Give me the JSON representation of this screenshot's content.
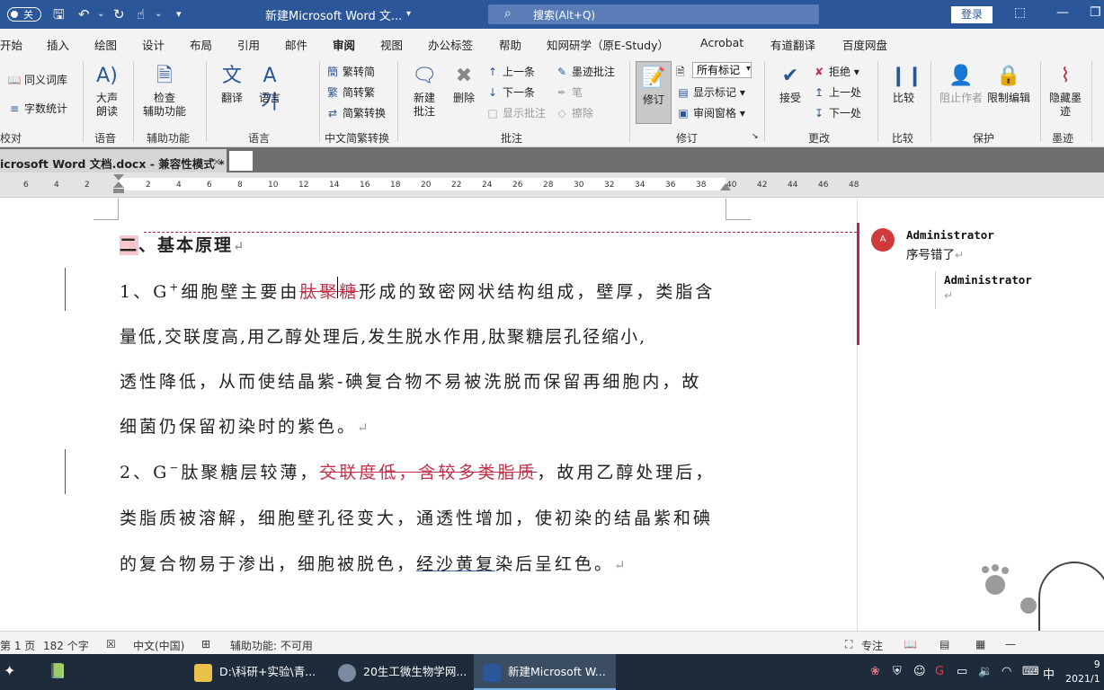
{
  "titlebar": {
    "autosave_label": "关",
    "doc_title": "新建Microsoft Word 文...",
    "search_placeholder": "搜索(Alt+Q)",
    "login_label": "登录"
  },
  "tabs": [
    "开始",
    "插入",
    "绘图",
    "设计",
    "布局",
    "引用",
    "邮件",
    "审阅",
    "视图",
    "办公标签",
    "帮助",
    "知网研学（原E-Study）",
    "Acrobat",
    "有道翻译",
    "百度网盘"
  ],
  "active_tab": "审阅",
  "ribbon": {
    "proofing": {
      "synonyms": "同义词库",
      "word_count": "字数统计",
      "label": "校对"
    },
    "speech": {
      "read_aloud": "大声\n朗读",
      "label": "语音"
    },
    "accessibility": {
      "check": "检查\n辅助功能",
      "label": "辅助功能"
    },
    "language": {
      "translate": "翻译",
      "language": "语言",
      "label": "语言"
    },
    "chinese": {
      "t2s": "繁转简",
      "s2t": "简转繁",
      "convert": "简繁转换",
      "label": "中文简繁转换"
    },
    "comments": {
      "new": "新建\n批注",
      "delete": "删除",
      "prev": "上一条",
      "next": "下一条",
      "show": "显示批注",
      "ink": "墨迹批注",
      "pen": "笔",
      "erase": "擦除",
      "label": "批注"
    },
    "tracking": {
      "track": "修订",
      "markup": "所有标记",
      "show_markup": "显示标记",
      "pane": "审阅窗格",
      "label": "修订"
    },
    "changes": {
      "accept": "接受",
      "reject": "拒绝",
      "prev": "上一处",
      "next": "下一处",
      "label": "更改"
    },
    "compare": {
      "compare": "比较",
      "label": "比较"
    },
    "protect": {
      "block": "阻止作者",
      "restrict": "限制编辑",
      "label": "保护"
    },
    "ink": {
      "hide": "隐藏墨\n迹",
      "label": "墨迹"
    }
  },
  "doc_tab": {
    "name": "icrosoft Word 文档.docx  -  兼容性模式 *",
    "close": "×"
  },
  "ruler_numbers": [
    "6",
    "4",
    "2",
    "2",
    "4",
    "6",
    "8",
    "10",
    "12",
    "14",
    "16",
    "18",
    "20",
    "22",
    "24",
    "26",
    "28",
    "30",
    "32",
    "34",
    "36",
    "38",
    "40",
    "42",
    "44",
    "46",
    "48"
  ],
  "document": {
    "heading_num": "二",
    "heading_rest": "、基本原理",
    "p1_a": "1、G",
    "p1_sup": "+",
    "p1_b": "细胞壁主要由",
    "p1_del": "肽聚糖",
    "p1_c": "形成的致密网状结构组成，壁厚，类脂含",
    "p1_l2": "量低,交联度高,用乙醇处理后,发生脱水作用,肽聚糖层孔径缩小,",
    "p1_l3": "透性降低，从而使结晶紫-碘复合物不易被洗脱而保留再细胞内，故",
    "p1_l4": "细菌仍保留初染时的紫色。",
    "p2_a": "2、G",
    "p2_sup": "−",
    "p2_b": "肽聚糖层较薄，",
    "p2_del": "交联度低，含较多类脂质",
    "p2_c": "，故用乙醇处理后，",
    "p2_l2": "类脂质被溶解，细胞壁孔径变大，通透性增加，使初染的结晶紫和碘",
    "p2_l3a": "的复合物易于渗出，细胞被脱色，",
    "p2_l3u": "经沙黄复",
    "p2_l3b": "染后呈红色。",
    "para_mark": "↵"
  },
  "comments": [
    {
      "avatar": "A",
      "author": "Administrator",
      "text": "序号错了"
    },
    {
      "author": "Administrator",
      "text": ""
    }
  ],
  "status": {
    "page": "第 1 页",
    "words": "182 个字",
    "lang": "中文(中国)",
    "access": "辅助功能: 不可用",
    "focus": "专注"
  },
  "taskbar": {
    "items": [
      "D:\\科研+实验\\青...",
      "20生工微生物学网...",
      "新建Microsoft W..."
    ],
    "ime": "中",
    "clock_time": "9",
    "clock_date": "2021/1"
  },
  "colors": {
    "word_blue": "#2b579a",
    "revision": "#c0304a"
  }
}
